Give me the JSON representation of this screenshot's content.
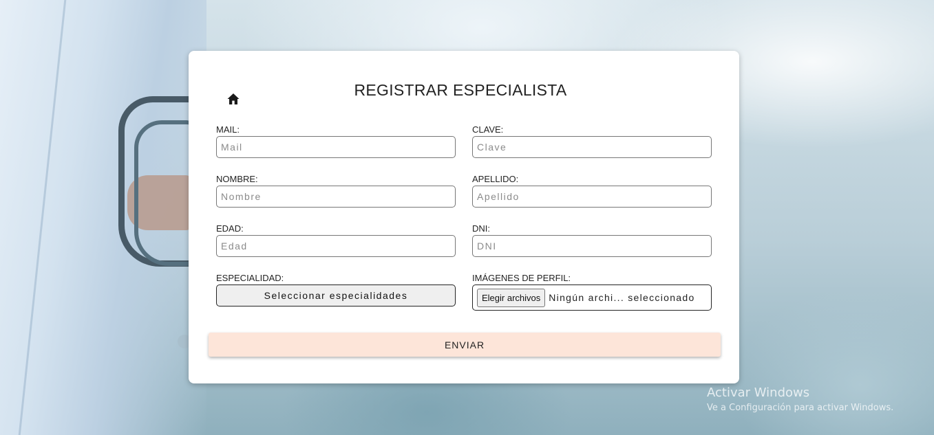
{
  "form": {
    "title": "REGISTRAR ESPECIALISTA",
    "home_icon": "home-icon",
    "fields": {
      "mail": {
        "label": "MAIL:",
        "placeholder": "Mail",
        "value": ""
      },
      "clave": {
        "label": "CLAVE:",
        "placeholder": "Clave",
        "value": ""
      },
      "nombre": {
        "label": "NOMBRE:",
        "placeholder": "Nombre",
        "value": ""
      },
      "apellido": {
        "label": "APELLIDO:",
        "placeholder": "Apellido",
        "value": ""
      },
      "edad": {
        "label": "EDAD:",
        "placeholder": "Edad",
        "value": ""
      },
      "dni": {
        "label": "DNI:",
        "placeholder": "DNI",
        "value": ""
      },
      "especialidad": {
        "label": "ESPECIALIDAD:",
        "button_label": "Seleccionar especialidades"
      },
      "imagenes": {
        "label": "IMÁGENES DE PERFIL:",
        "button_label": "Elegir archivos",
        "status": "Ningún archi... seleccionado"
      }
    },
    "submit_label": "ENVIAR"
  },
  "watermark": {
    "title": "Activar Windows",
    "subtitle": "Ve a Configuración para activar Windows."
  }
}
